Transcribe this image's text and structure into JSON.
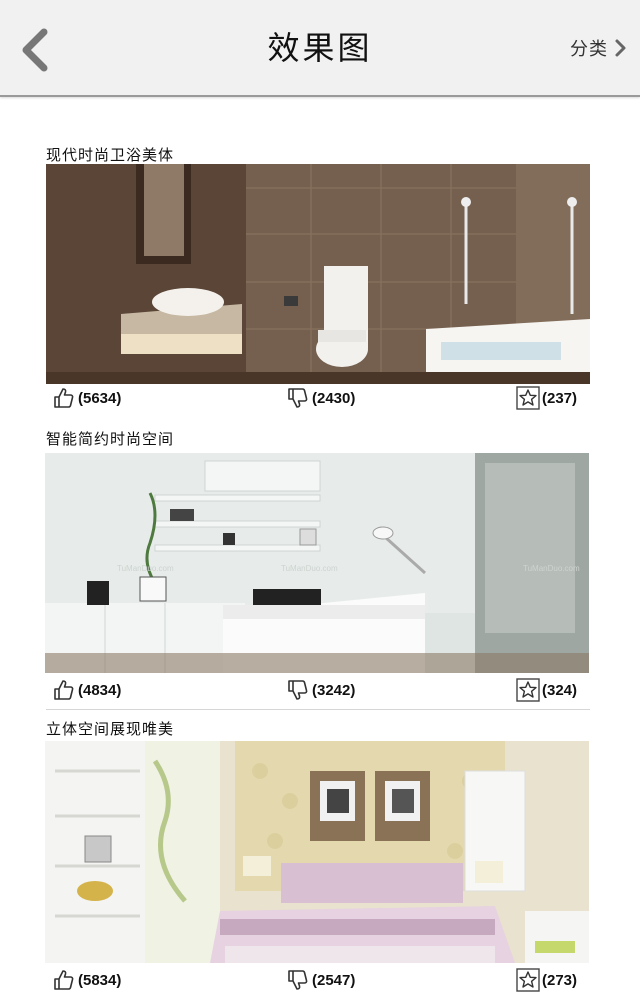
{
  "header": {
    "title": "效果图",
    "category_label": "分类"
  },
  "posts": [
    {
      "title": "现代时尚卫浴美体",
      "likes": "(5634)",
      "dislikes": "(2430)",
      "favorites": "(237)"
    },
    {
      "title": "智能简约时尚空间",
      "likes": "(4834)",
      "dislikes": "(3242)",
      "favorites": "(324)"
    },
    {
      "title": "立体空间展现唯美",
      "likes": "(5834)",
      "dislikes": "(2547)",
      "favorites": "(273)"
    }
  ]
}
